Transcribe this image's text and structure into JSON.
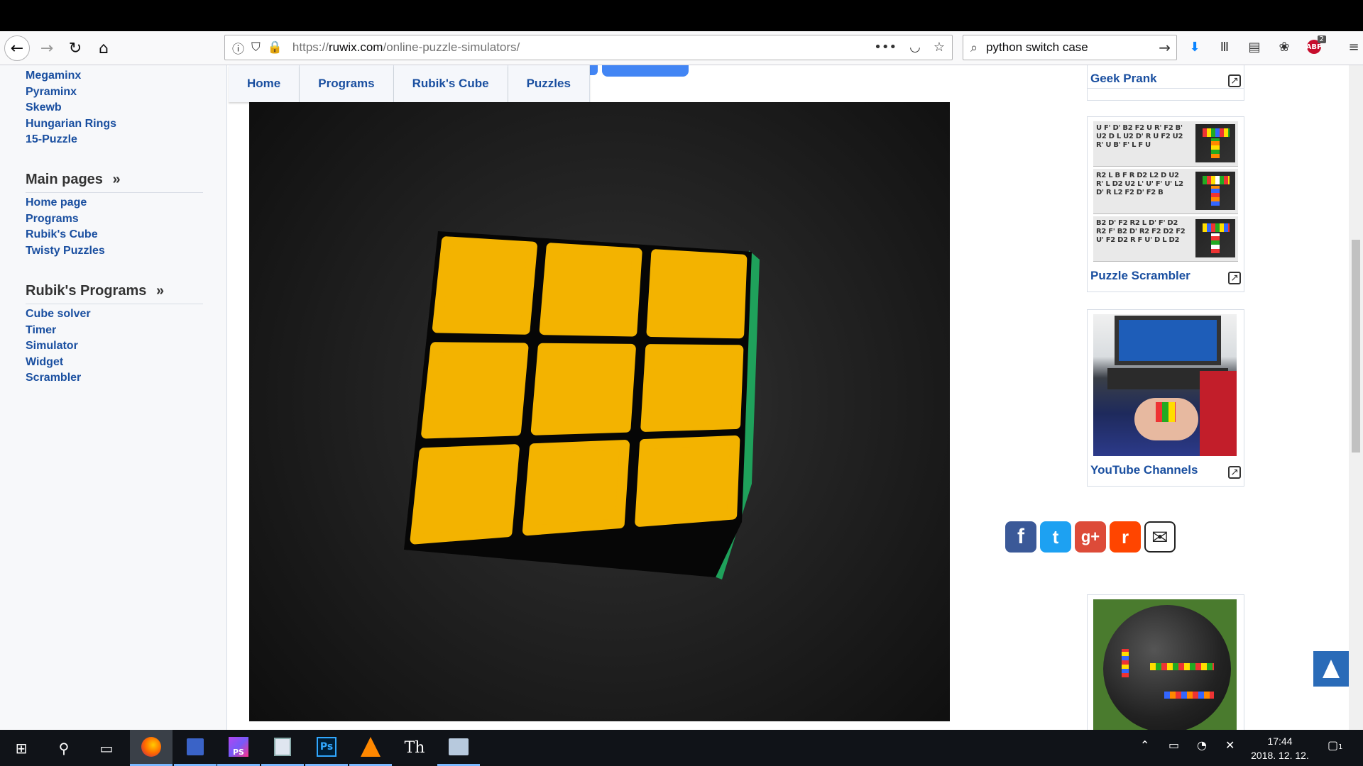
{
  "browser": {
    "url_scheme": "https://",
    "url_domain": "ruwix.com",
    "url_path": "/online-puzzle-simulators/",
    "search_value": "python switch case",
    "abp_badge": "2",
    "icons": [
      "back-icon",
      "forward-icon",
      "reload-icon",
      "home-icon",
      "info-icon",
      "shield-icon",
      "lock-icon",
      "page-actions-icon",
      "pocket-icon",
      "bookmark-star-icon",
      "search-icon",
      "go-arrow-icon",
      "download-icon",
      "library-icon",
      "sidebar-icon",
      "extension-icon",
      "adblock-icon",
      "menu-icon"
    ]
  },
  "tabs": [
    "Home",
    "Programs",
    "Rubik's Cube",
    "Puzzles"
  ],
  "sidebar": {
    "puzzles": [
      "Megaminx",
      "Pyraminx",
      "Skewb",
      "Hungarian Rings",
      "15-Puzzle"
    ],
    "main_pages_title": "Main pages",
    "main_pages_chevron": "»",
    "main_pages": [
      "Home page",
      "Programs",
      "Rubik's Cube",
      "Twisty Puzzles"
    ],
    "programs_title": "Rubik's Programs",
    "programs_chevron": "»",
    "programs": [
      "Cube solver",
      "Timer",
      "Simulator",
      "Widget",
      "Scrambler"
    ]
  },
  "simulator": {
    "face_color": "#f3b300",
    "side_color": "#1fa15b",
    "background": "#1b1b1b"
  },
  "cards": {
    "geek_prank": "Geek Prank",
    "puzzle_scrambler": "Puzzle Scrambler",
    "youtube_channels": "YouTube Channels",
    "scrambles": [
      "U F' D' B2 F2 U R' F2 B' U2 D L U2 D' R U F2 U2 R' U B' F' L F U",
      "R2 L B F R D2 L2 D U2 R' L D2 U2 L' U' F' U' L2 D' R L2 F2 D' F2 B",
      "B2 D' F2 R2 L D' F' D2 R2 F' B2 D' R2 F2 D2 F2 U' F2 D2 R F U' D L D2"
    ]
  },
  "social": [
    {
      "name": "facebook",
      "glyph": "f",
      "color": "#3b5998"
    },
    {
      "name": "twitter",
      "glyph": "t",
      "color": "#1da1f2"
    },
    {
      "name": "google-plus",
      "glyph": "g+",
      "color": "#dd4b39"
    },
    {
      "name": "reddit",
      "glyph": "r",
      "color": "#ff4500"
    },
    {
      "name": "email",
      "glyph": "✉",
      "color": "#ffffff"
    }
  ],
  "taskbar": {
    "time": "17:44",
    "date": "2018. 12. 12.",
    "notification_count": "1",
    "apps": [
      "start",
      "search",
      "task-view",
      "firefox",
      "save-disk",
      "phpstorm",
      "editor",
      "photoshop",
      "vlc",
      "th-app",
      "app-stack"
    ]
  }
}
